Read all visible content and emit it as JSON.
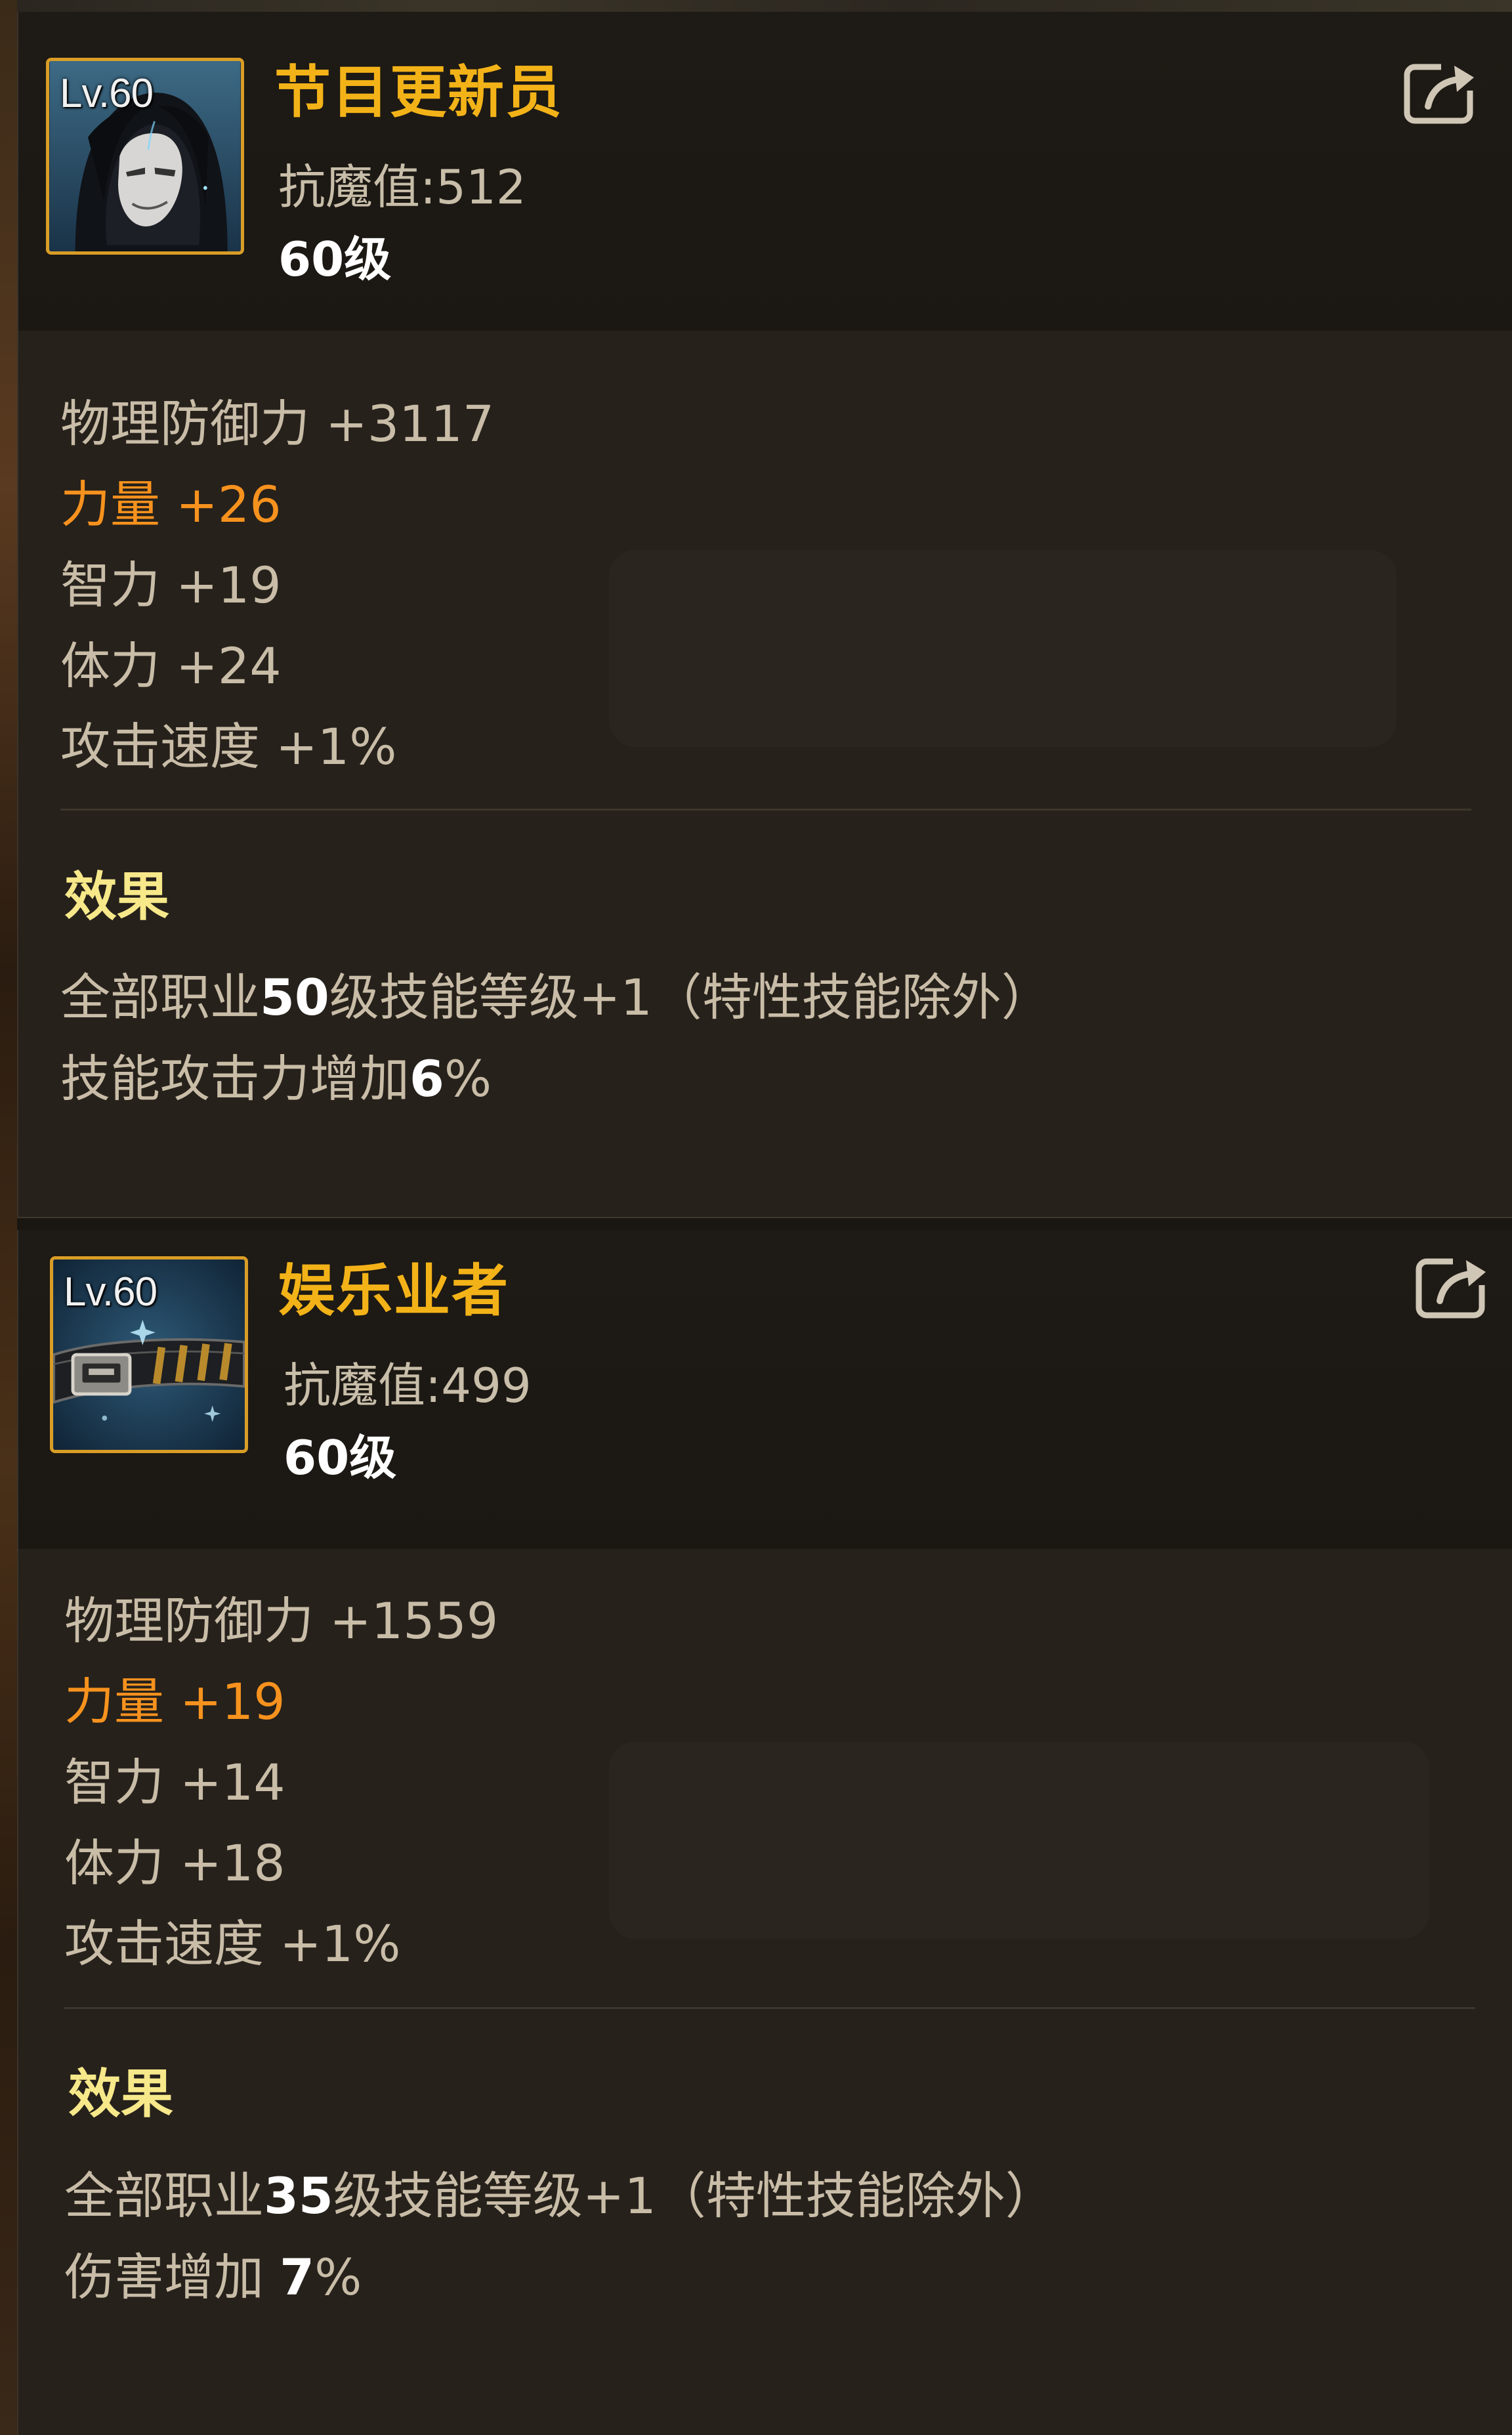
{
  "items": [
    {
      "icon_name": "hooded-character-portrait",
      "level_badge": "Lv.60",
      "name": "节目更新员",
      "resist": "抗魔值:512",
      "level_req": "60级",
      "stats": [
        {
          "label": "物理防御力 +3117",
          "highlight": false
        },
        {
          "label": "力量 +26",
          "highlight": true
        },
        {
          "label": "智力 +19",
          "highlight": false
        },
        {
          "label": "体力 +24",
          "highlight": false
        },
        {
          "label": "攻击速度 +1%",
          "highlight": false
        }
      ],
      "effect_title": "效果",
      "effects": [
        {
          "pre": "全部职业",
          "num": "50",
          "post": "级技能等级+1（特性技能除外）"
        },
        {
          "pre": "技能攻击力增加",
          "num": "6",
          "post": "%"
        }
      ]
    },
    {
      "icon_name": "belt-icon",
      "level_badge": "Lv.60",
      "name": "娱乐业者",
      "resist": "抗魔值:499",
      "level_req": "60级",
      "stats": [
        {
          "label": "物理防御力 +1559",
          "highlight": false
        },
        {
          "label": "力量 +19",
          "highlight": true
        },
        {
          "label": "智力 +14",
          "highlight": false
        },
        {
          "label": "体力 +18",
          "highlight": false
        },
        {
          "label": "攻击速度 +1%",
          "highlight": false
        }
      ],
      "effect_title": "效果",
      "effects": [
        {
          "pre": "全部职业",
          "num": "35",
          "post": "级技能等级+1（特性技能除外）"
        },
        {
          "pre": "伤害增加 ",
          "num": "7",
          "post": "%"
        }
      ]
    }
  ],
  "colors": {
    "name": "#f3b318",
    "highlight": "#f7921e",
    "effect_title": "#f7e88a",
    "frame": "#d99d26"
  },
  "icons": {
    "share": "share-export-icon"
  }
}
